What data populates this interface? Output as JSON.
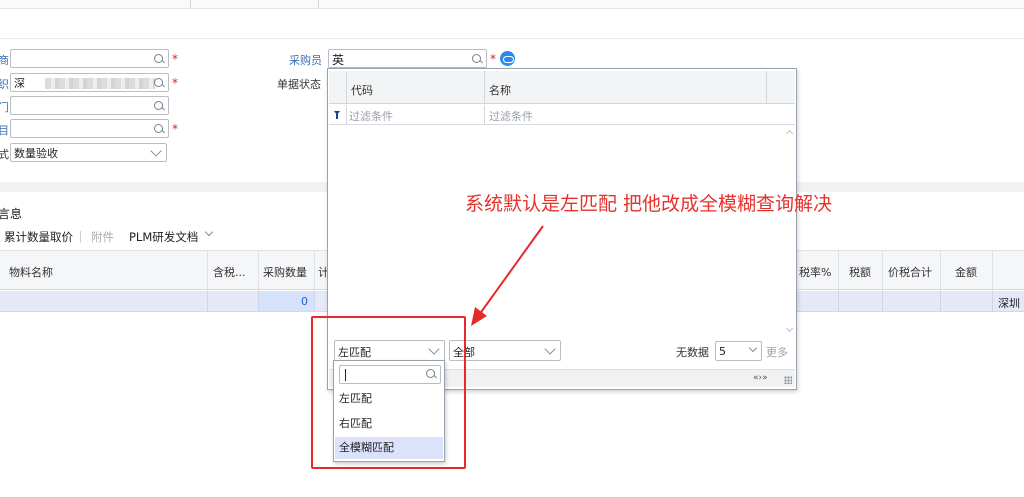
{
  "form": {
    "purchaser_label": "采购员",
    "purchaser_value": "英",
    "doc_status_label": "单据状态",
    "org_value": "深",
    "accept_method_label": "式",
    "accept_method_value": "数量验收",
    "left_labels": [
      "商",
      "织",
      "门",
      "目"
    ]
  },
  "lookup": {
    "columns": [
      "代码",
      "名称"
    ],
    "filter_placeholders": [
      "过滤条件",
      "过滤条件"
    ],
    "match_mode_value": "左匹配",
    "scope_value": "全部",
    "no_data_label": "无数据",
    "page_size_value": "5",
    "more_label": "更多",
    "statusbar_arrows": "«›»"
  },
  "match_dropdown": {
    "search_value": "",
    "options": [
      "左匹配",
      "右匹配",
      "全模糊匹配"
    ]
  },
  "annotation": {
    "text": "系统默认是左匹配  把他改成全模糊查询解决"
  },
  "detail": {
    "section_title": "言息",
    "toolbar": {
      "cumulative_qty": "累计数量取价",
      "attachment": "附件",
      "plm_docs": "PLM研发文档"
    },
    "columns": [
      "物料名称",
      "含税...",
      "采购数量",
      "计",
      "税率%",
      "税额",
      "价税合计",
      "金额"
    ],
    "row": {
      "purchase_qty": "0",
      "last_cell": "深圳"
    }
  }
}
